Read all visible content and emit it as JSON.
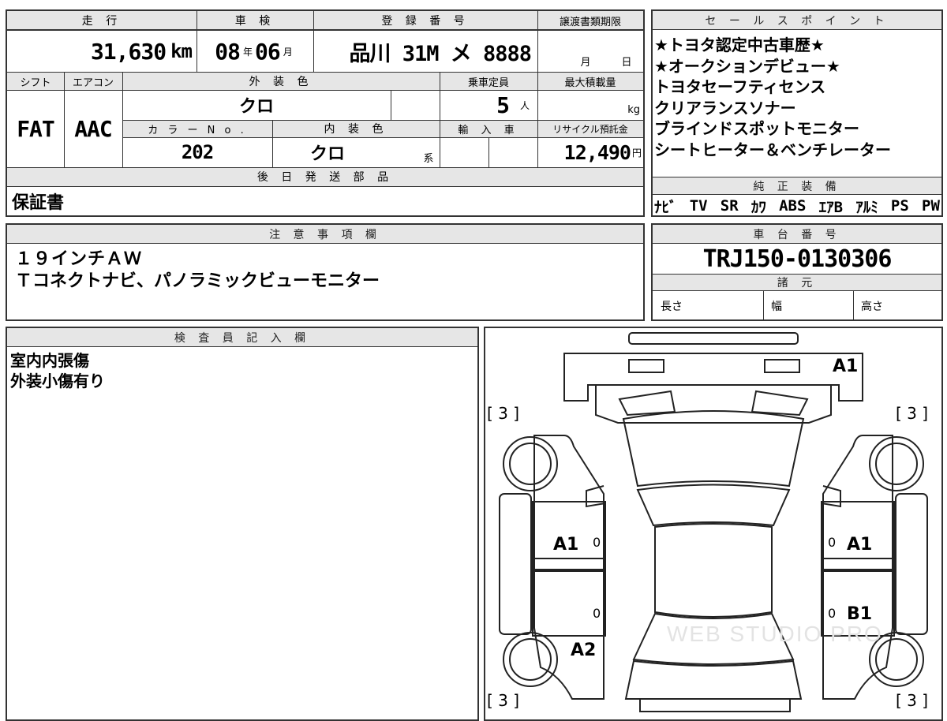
{
  "top": {
    "mileage_label": "走 行",
    "mileage_value": "31,630",
    "mileage_unit": "km",
    "shaken_label": "車 検",
    "shaken_year": "08",
    "shaken_year_unit": "年",
    "shaken_month": "06",
    "shaken_month_unit": "月",
    "reg_label": "登 録 番 号",
    "reg_value": "品川 31M メ 8888",
    "transfer_label": "譲渡書類期限",
    "transfer_month": "月",
    "transfer_day": "日",
    "shift_label": "シフト",
    "shift_value": "FAT",
    "ac_label": "エアコン",
    "ac_value": "AAC",
    "ext_color_label": "外 装 色",
    "ext_color_value": "クロ",
    "capacity_label": "乗車定員",
    "capacity_value": "5",
    "capacity_unit": "人",
    "maxload_label": "最大積載量",
    "maxload_unit": "kg",
    "colorno_label": "カ ラ ー N o .",
    "colorno_value": "202",
    "int_color_label": "内 装 色",
    "int_color_value": "クロ",
    "int_color_unit": "系",
    "import_label": "輸 入 車",
    "recycle_label": "リサイクル預託金",
    "recycle_value": "12,490",
    "recycle_unit": "円",
    "later_label": "後 日 発 送 部 品",
    "later_value": "保証書"
  },
  "sales": {
    "label": "セ ー ル ス ポ イ ン ト",
    "points": [
      "★トヨタ認定中古車歴★",
      "★オークションデビュー★",
      "トヨタセーフティセンス",
      "クリアランスソナー",
      "ブラインドスポットモニター",
      "シートヒーター＆ベンチレーター"
    ]
  },
  "equipment": {
    "label": "純 正 装 備",
    "items": [
      "ﾅﾋﾞ",
      "TV",
      "SR",
      "ｶﾜ",
      "ABS",
      "ｴｱB",
      "ｱﾙﾐ",
      "PS",
      "PW"
    ]
  },
  "notes": {
    "label": "注 意 事 項 欄",
    "lines": [
      "１９インチＡＷ",
      "Ｔコネクトナビ、パノラミックビューモニター"
    ]
  },
  "chassis": {
    "label": "車 台 番 号",
    "value": "TRJ150-0130306"
  },
  "specs": {
    "label": "諸 元",
    "length": "長さ",
    "width": "幅",
    "height": "高さ"
  },
  "inspector": {
    "label": "検 査 員 記 入 欄",
    "lines": [
      "室内内張傷",
      "外装小傷有り"
    ]
  },
  "diagram": {
    "tire_mark": "[ 3 ]",
    "front_mark": "A1",
    "left_front_door": "A1",
    "right_front_door": "A1",
    "right_rear_door": "B1",
    "left_rear": "A2",
    "zero": "0",
    "watermark": "WEB STUDIO PRO"
  }
}
